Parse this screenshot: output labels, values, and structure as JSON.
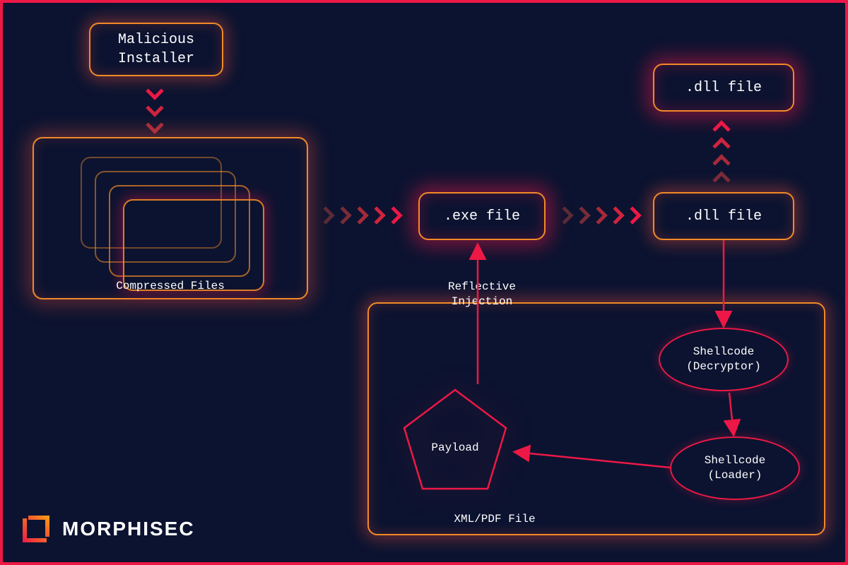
{
  "brand": {
    "name": "MORPHISEC"
  },
  "nodes": {
    "malicious_installer": "Malicious\nInstaller",
    "compressed_files_caption": "Compressed Files",
    "exe_file": ".exe file",
    "dll_file_mid": ".dll file",
    "dll_file_top": ".dll file",
    "xmlpdf_caption": "XML/PDF File",
    "shellcode_decryptor": "Shellcode\n(Decryptor)",
    "shellcode_loader": "Shellcode\n(Loader)",
    "payload": "Payload",
    "reflective_injection": "Reflective\nInjection"
  },
  "colors": {
    "bg": "#0b1330",
    "frame": "#ed1846",
    "node_border": "#f08a27",
    "accent": "#ed1846"
  }
}
